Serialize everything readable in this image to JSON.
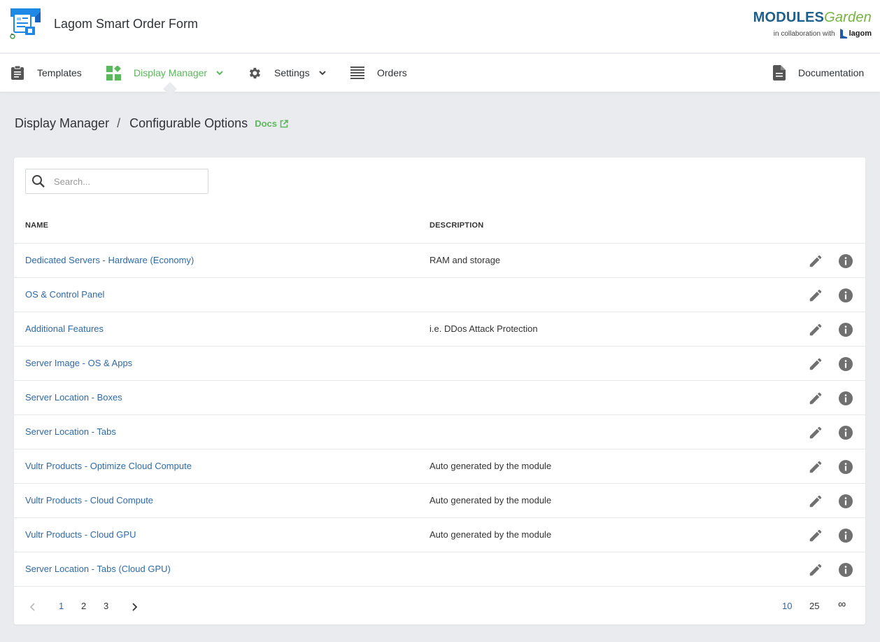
{
  "app": {
    "title": "Lagom Smart Order Form",
    "brand_modules": "MODULES",
    "brand_garden": "Garden",
    "brand_collab": "in collaboration with",
    "brand_partner": "lagom"
  },
  "nav": {
    "items": [
      {
        "label": "Templates",
        "icon": "clipboard-icon"
      },
      {
        "label": "Display Manager",
        "icon": "widgets-icon",
        "active": true,
        "dropdown": true
      },
      {
        "label": "Settings",
        "icon": "gear-icon",
        "dropdown": true
      },
      {
        "label": "Orders",
        "icon": "list-icon"
      }
    ],
    "documentation": "Documentation"
  },
  "breadcrumb": {
    "parent": "Display Manager",
    "separator": "/",
    "current": "Configurable Options",
    "docs": "Docs"
  },
  "search": {
    "placeholder": "Search...",
    "value": ""
  },
  "table": {
    "headers": {
      "name": "NAME",
      "description": "DESCRIPTION"
    },
    "rows": [
      {
        "name": "Dedicated Servers - Hardware (Economy)",
        "description": "RAM and storage"
      },
      {
        "name": "OS & Control Panel",
        "description": ""
      },
      {
        "name": "Additional Features",
        "description": "i.e. DDos Attack Protection"
      },
      {
        "name": "Server Image - OS & Apps",
        "description": ""
      },
      {
        "name": "Server Location - Boxes",
        "description": ""
      },
      {
        "name": "Server Location - Tabs",
        "description": ""
      },
      {
        "name": "Vultr Products - Optimize Cloud Compute",
        "description": "Auto generated by the module"
      },
      {
        "name": "Vultr Products - Cloud Compute",
        "description": "Auto generated by the module"
      },
      {
        "name": "Vultr Products - Cloud GPU",
        "description": "Auto generated by the module"
      },
      {
        "name": "Server Location - Tabs (Cloud GPU)",
        "description": ""
      }
    ]
  },
  "pagination": {
    "pages": [
      "1",
      "2",
      "3"
    ],
    "current_page": "1",
    "page_sizes": [
      "10",
      "25",
      "∞"
    ],
    "current_size": "10"
  },
  "colors": {
    "accent_green": "#5cb85c",
    "link_blue": "#2e6aa8",
    "background": "#e9ebef",
    "icon_gray": "#707070"
  }
}
